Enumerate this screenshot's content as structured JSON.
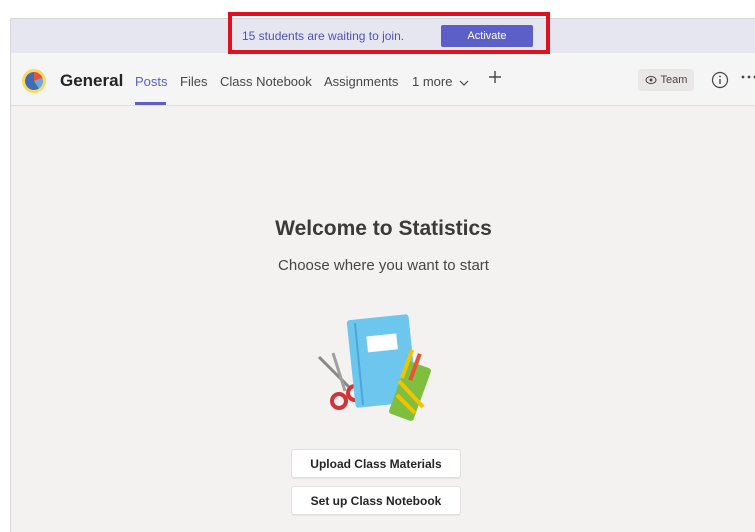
{
  "banner": {
    "message": "15 students are waiting to join.",
    "activate_label": "Activate"
  },
  "header": {
    "channel_title": "General",
    "tabs": [
      {
        "label": "Posts",
        "active": true
      },
      {
        "label": "Files"
      },
      {
        "label": "Class Notebook"
      },
      {
        "label": "Assignments"
      },
      {
        "label": "1 more"
      }
    ],
    "team_button_label": "Team"
  },
  "main": {
    "title": "Welcome to Statistics",
    "subtitle": "Choose where you want to start",
    "upload_button": "Upload Class Materials",
    "notebook_button": "Set up Class Notebook"
  },
  "colors": {
    "accent": "#5b5fc7",
    "highlight_border": "#e0111e",
    "banner_bg": "#e6e6f1"
  },
  "icons": [
    "pie-chart-logo",
    "chevron-down-icon",
    "plus-icon",
    "eye-icon",
    "info-icon",
    "more-icon"
  ]
}
